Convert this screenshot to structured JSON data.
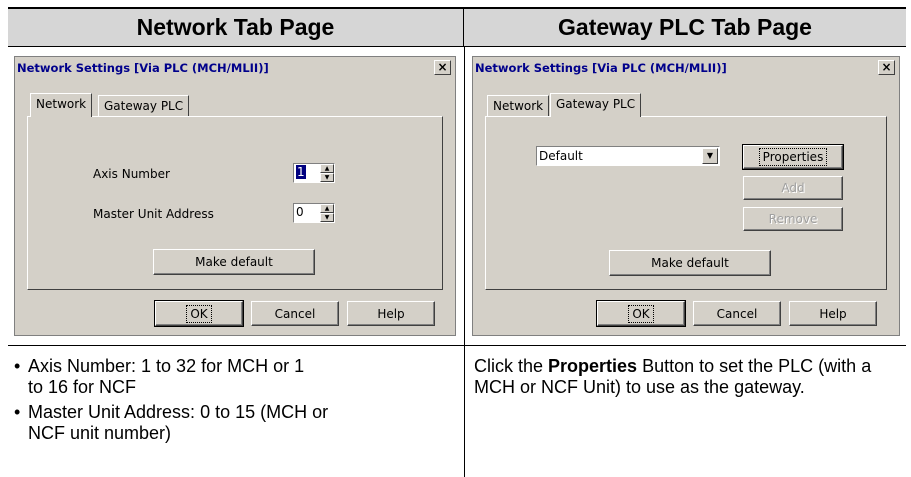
{
  "headers": {
    "left": "Network Tab Page",
    "right": "Gateway PLC Tab Page"
  },
  "left_dialog": {
    "title": "Network Settings [Via PLC (MCH/MLII)]",
    "close_glyph": "×",
    "tabs": [
      "Network",
      "Gateway PLC"
    ],
    "axis_label": "Axis Number",
    "axis_value": "1",
    "master_label": "Master Unit Address",
    "master_value": "0",
    "make_default": "Make default",
    "ok": "OK",
    "cancel": "Cancel",
    "help": "Help"
  },
  "right_dialog": {
    "title": "Network Settings [Via PLC (MCH/MLII)]",
    "close_glyph": "×",
    "tabs": [
      "Network",
      "Gateway PLC"
    ],
    "combo_value": "Default",
    "properties": "Properties",
    "add": "Add",
    "remove": "Remove",
    "make_default": "Make default",
    "ok": "OK",
    "cancel": "Cancel",
    "help": "Help"
  },
  "notes": {
    "left": {
      "bullet_glyph": "•",
      "item1": "Axis Number: 1 to 32 for MCH or 1 to 16 for NCF",
      "item2": "Master Unit Address: 0 to 15 (MCH or NCF unit number)"
    },
    "right": {
      "pre": "Click the ",
      "bold": "Properties",
      "post": " Button to set the PLC (with a MCH or NCF Unit) to use as the gateway."
    }
  }
}
